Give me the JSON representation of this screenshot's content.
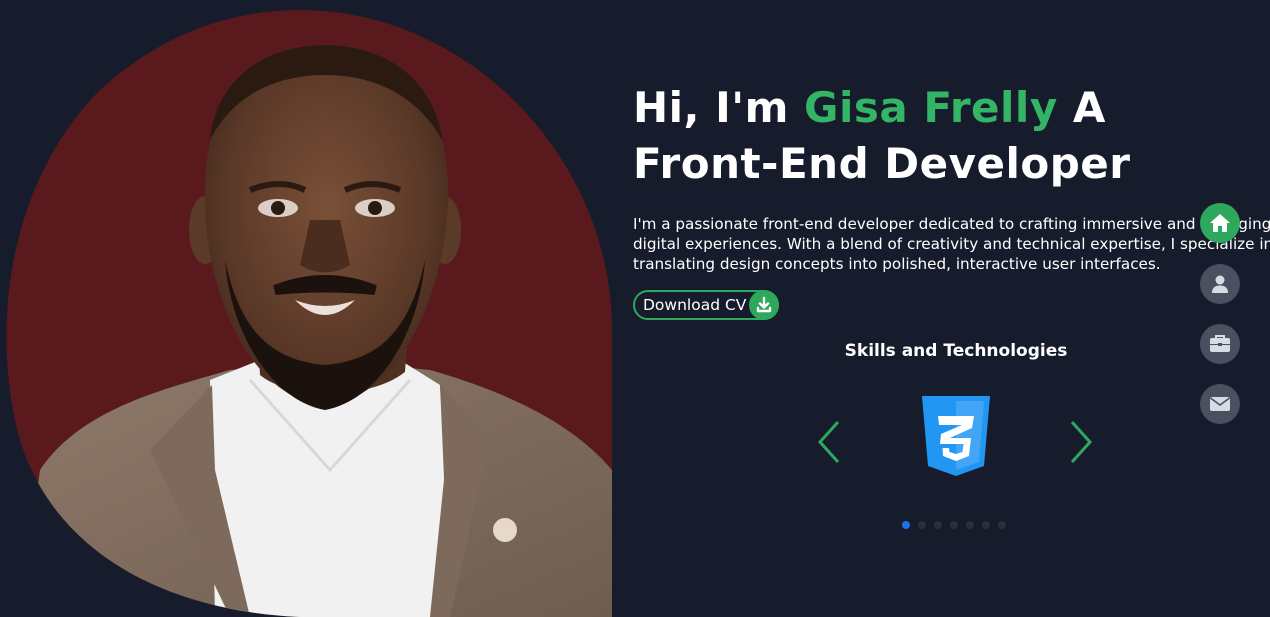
{
  "hero": {
    "greeting": "Hi, I'm ",
    "name": "Gisa Frelly",
    "role": " A Front-End Developer",
    "description": "I'm a passionate front-end developer dedicated to crafting immersive and engaging digital experiences. With a blend of creativity and technical expertise, I specialize in translating design concepts into polished, interactive user interfaces.",
    "cv_button_label": "Download CV",
    "cv_icon": "download-icon"
  },
  "skills": {
    "title": "Skills and Technologies",
    "current_skill_icon": "css3-icon",
    "slide_count": 7,
    "active_slide": 1,
    "prev_icon": "chevron-left-icon",
    "next_icon": "chevron-right-icon"
  },
  "side_nav": {
    "items": [
      {
        "icon": "home-icon",
        "active": true
      },
      {
        "icon": "user-icon",
        "active": false
      },
      {
        "icon": "briefcase-icon",
        "active": false
      },
      {
        "icon": "envelope-icon",
        "active": false
      }
    ]
  },
  "colors": {
    "background": "#171c2c",
    "accent": "#33b565",
    "portrait_backdrop": "#5a1a1d",
    "css3_blue": "#2196f3",
    "nav_inactive": "#4a505f",
    "dot_active": "#1a73e8"
  }
}
